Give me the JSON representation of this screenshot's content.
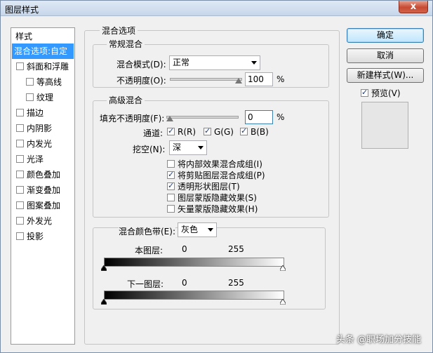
{
  "window": {
    "title": "图层样式",
    "close_label": "x"
  },
  "sidebar": {
    "header": "样式",
    "items": [
      {
        "label": "混合选项:自定",
        "selected": true,
        "checkbox": false
      },
      {
        "label": "斜面和浮雕",
        "checkbox": true
      },
      {
        "label": "等高线",
        "checkbox": true,
        "indent": true
      },
      {
        "label": "纹理",
        "checkbox": true,
        "indent": true
      },
      {
        "label": "描边",
        "checkbox": true
      },
      {
        "label": "内阴影",
        "checkbox": true
      },
      {
        "label": "内发光",
        "checkbox": true
      },
      {
        "label": "光泽",
        "checkbox": true
      },
      {
        "label": "颜色叠加",
        "checkbox": true
      },
      {
        "label": "渐变叠加",
        "checkbox": true
      },
      {
        "label": "图案叠加",
        "checkbox": true
      },
      {
        "label": "外发光",
        "checkbox": true
      },
      {
        "label": "投影",
        "checkbox": true
      }
    ]
  },
  "blend": {
    "title": "混合选项",
    "general": {
      "title": "常规混合",
      "mode_label": "混合模式(D):",
      "mode_value": "正常",
      "opacity_label": "不透明度(O):",
      "opacity_value": "100",
      "opacity_unit": "%",
      "opacity_level": 1.0
    },
    "advanced": {
      "title": "高级混合",
      "fill_label": "填充不透明度(F):",
      "fill_value": "0",
      "fill_unit": "%",
      "fill_level": 0,
      "channels_label": "通道:",
      "ch_r": "R(R)",
      "ch_g": "G(G)",
      "ch_b": "B(B)",
      "knockout_label": "挖空(N):",
      "knockout_value": "深",
      "options": [
        {
          "label": "将内部效果混合成组(I)",
          "checked": false
        },
        {
          "label": "将剪贴图层混合成组(P)",
          "checked": true
        },
        {
          "label": "透明形状图层(T)",
          "checked": true
        },
        {
          "label": "图层蒙版隐藏效果(S)",
          "checked": false
        },
        {
          "label": "矢量蒙版隐藏效果(H)",
          "checked": false
        }
      ]
    },
    "blendif": {
      "label": "混合颜色带(E):",
      "value": "灰色",
      "this_layer": {
        "label": "本图层:",
        "low": "0",
        "high": "255"
      },
      "under_layer": {
        "label": "下一图层:",
        "low": "0",
        "high": "255"
      }
    }
  },
  "buttons": {
    "ok": "确定",
    "cancel": "取消",
    "new_style": "新建样式(W)...",
    "preview": "预览(V)"
  },
  "watermark": "头条 @职场加分技能"
}
